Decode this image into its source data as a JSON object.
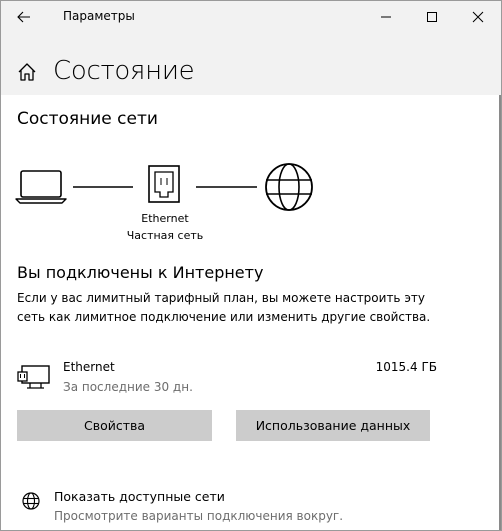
{
  "window": {
    "app_title": "Параметры",
    "buttons": {
      "back": "back-arrow-icon",
      "minimize": "minimize-icon",
      "maximize": "maximize-icon",
      "close": "close-icon"
    }
  },
  "header": {
    "icon": "home-icon",
    "title": "Состояние"
  },
  "network_status": {
    "section_title": "Состояние сети",
    "diagram": {
      "nodes": [
        "laptop-icon",
        "ethernet-adapter-icon",
        "globe-icon"
      ],
      "adapter_name": "Ethernet",
      "network_type": "Частная сеть"
    },
    "connected_title": "Вы подключены к Интернету",
    "connected_desc": "Если у вас лимитный тарифный план, вы можете настроить эту сеть как лимитное подключение или изменить другие свойства."
  },
  "adapter": {
    "icon": "ethernet-pc-icon",
    "name": "Ethernet",
    "period": "За последние 30 дн.",
    "usage": "1015.4 ГБ"
  },
  "buttons": {
    "properties": "Свойства",
    "data_usage": "Использование данных"
  },
  "show_networks": {
    "icon": "network-globe-icon",
    "label": "Показать доступные сети",
    "description": "Просмотрите варианты подключения вокруг."
  }
}
